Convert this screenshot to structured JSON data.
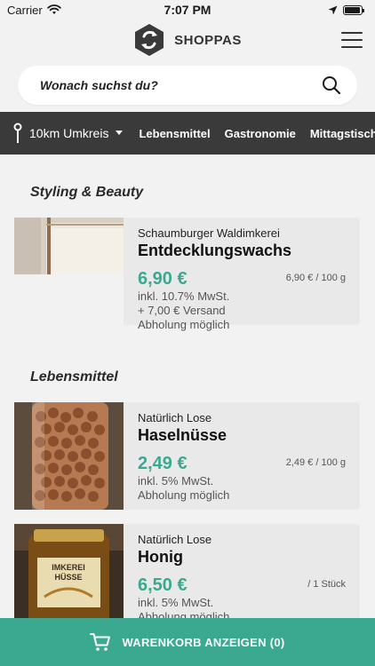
{
  "status": {
    "carrier": "Carrier",
    "time": "7:07 PM",
    "battery_level": 0.95
  },
  "header": {
    "brand": "SHOPPAS"
  },
  "search": {
    "placeholder": "Wonach suchst du?"
  },
  "filters": {
    "radius": "10km Umkreis",
    "categories": [
      "Lebensmittel",
      "Gastronomie",
      "Mittagstisch"
    ]
  },
  "sections": [
    {
      "title": "Styling & Beauty",
      "items": [
        {
          "vendor": "Schaumburger Waldimkerei",
          "name": "Entdecklungswachs",
          "price": "6,90 €",
          "unit_price": "6,90 € / 100 g",
          "tax": "inkl. 10.7% MwSt.",
          "shipping": "+ 7,00 € Versand",
          "pickup": "Abholung möglich"
        }
      ]
    },
    {
      "title": "Lebensmittel",
      "items": [
        {
          "vendor": "Natürlich Lose",
          "name": "Haselnüsse",
          "price": "2,49 €",
          "unit_price": "2,49 € / 100 g",
          "tax": "inkl. 5% MwSt.",
          "pickup": "Abholung möglich"
        },
        {
          "vendor": "Natürlich Lose",
          "name": "Honig",
          "price": "6,50 €",
          "unit_price": "/ 1 Stück",
          "tax": "inkl. 5% MwSt.",
          "pickup": "Abholung möglich",
          "label_text": "IMKEREI HÜSSE"
        }
      ]
    }
  ],
  "cart": {
    "label": "WARENKORB ANZEIGEN (0)"
  },
  "colors": {
    "accent": "#3aa98f",
    "filter_bar": "#3a3a3a"
  }
}
